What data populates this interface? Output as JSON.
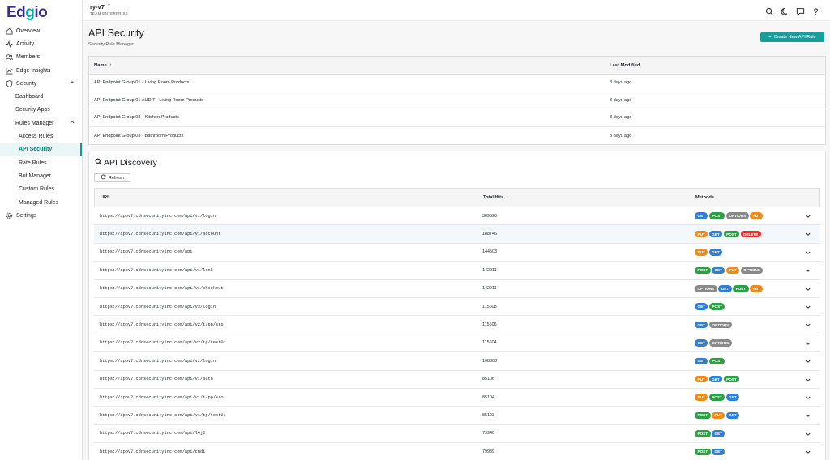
{
  "colors": {
    "accent": "#00a39c",
    "brand_purple": "#3d2e8c",
    "GET": "#2f80d1",
    "POST": "#2ea043",
    "OPTIONS": "#8a8a8a",
    "PUT": "#f08a16",
    "DELETE": "#e03131"
  },
  "logo": "Edgio",
  "sidebar": {
    "items": [
      {
        "label": "Overview",
        "icon": "home-icon"
      },
      {
        "label": "Activity",
        "icon": "activity-icon"
      },
      {
        "label": "Members",
        "icon": "members-icon"
      },
      {
        "label": "Edge Insights",
        "icon": "chart-icon"
      },
      {
        "label": "Security",
        "icon": "shield-icon"
      },
      {
        "label": "Dashboard"
      },
      {
        "label": "Security Apps"
      },
      {
        "label": "Rules Manager"
      },
      {
        "label": "Access Rules"
      },
      {
        "label": "API Security"
      },
      {
        "label": "Rate Rules"
      },
      {
        "label": "Bot Manager"
      },
      {
        "label": "Custom Rules"
      },
      {
        "label": "Managed Rules"
      },
      {
        "label": "Settings",
        "icon": "gear-icon"
      }
    ]
  },
  "topbar": {
    "team_name": "ry-v7",
    "team_type": "TEAM ENTERPRISE"
  },
  "page": {
    "title": "API Security",
    "subtitle": "Security Rule Manager",
    "create_button": "Create New API Rule"
  },
  "rules_table": {
    "col_name": "Name",
    "col_modified": "Last Modified",
    "rows": [
      {
        "name": "API Endpoint Group 01 - Living Room Products",
        "modified": "3 days ago"
      },
      {
        "name": "API Endpoint Group 01 AUDIT - Living Room Products",
        "modified": "3 days ago"
      },
      {
        "name": "API Endpoint Group 02 - Kitchen Products",
        "modified": "3 days ago"
      },
      {
        "name": "API Endpoint Group 03 - Bathroom Products",
        "modified": "3 days ago"
      }
    ]
  },
  "discovery": {
    "title": "API Discovery",
    "refresh": "Refresh",
    "col_url": "URL",
    "col_hits": "Total Hits",
    "col_methods": "Methods",
    "rows": [
      {
        "url": "https://appv7.cdnsecurityinc.com/api/v1/login",
        "hits": "309520",
        "methods": [
          "GET",
          "POST",
          "OPTIONS",
          "PUT"
        ]
      },
      {
        "url": "https://appv7.cdnsecurityinc.com/api/v1/account",
        "hits": "188746",
        "methods": [
          "PUT",
          "GET",
          "POST",
          "DELETE"
        ]
      },
      {
        "url": "https://appv7.cdnsecurityinc.com/api",
        "hits": "144503",
        "methods": [
          "PUT",
          "GET"
        ]
      },
      {
        "url": "https://appv7.cdnsecurityinc.com/api/v1/link",
        "hits": "142911",
        "methods": [
          "POST",
          "GET",
          "PUT",
          "OPTIONS"
        ]
      },
      {
        "url": "https://appv7.cdnsecurityinc.com/api/v1/checkout",
        "hits": "142911",
        "methods": [
          "OPTIONS",
          "GET",
          "POST",
          "PUT"
        ]
      },
      {
        "url": "https://appv7.cdnsecurityinc.com/api/v3/login",
        "hits": "115608",
        "methods": [
          "GET",
          "POST"
        ]
      },
      {
        "url": "https://appv7.cdnsecurityinc.com/api/v2/t/pp/sso",
        "hits": "115606",
        "methods": [
          "GET",
          "OPTIONS"
        ]
      },
      {
        "url": "https://appv7.cdnsecurityinc.com/api/v2/tp/test01",
        "hits": "115604",
        "methods": [
          "GET",
          "OPTIONS"
        ]
      },
      {
        "url": "https://appv7.cdnsecurityinc.com/api/v2/login",
        "hits": "108808",
        "methods": [
          "GET",
          "POST"
        ]
      },
      {
        "url": "https://appv7.cdnsecurityinc.com/api/v1/auth",
        "hits": "85106",
        "methods": [
          "PUT",
          "GET",
          "POST"
        ]
      },
      {
        "url": "https://appv7.cdnsecurityinc.com/api/v1/t/pp/sso",
        "hits": "85104",
        "methods": [
          "PUT",
          "POST",
          "GET"
        ]
      },
      {
        "url": "https://appv7.cdnsecurityinc.com/api/v1/tp/test01",
        "hits": "85103",
        "methods": [
          "POST",
          "PUT",
          "GET"
        ]
      },
      {
        "url": "https://appv7.cdnsecurityinc.com/api/l4j2",
        "hits": "79946",
        "methods": [
          "POST",
          "GET"
        ]
      },
      {
        "url": "https://appv7.cdnsecurityinc.com/api/cmdi",
        "hits": "79939",
        "methods": [
          "POST",
          "GET"
        ]
      }
    ]
  }
}
